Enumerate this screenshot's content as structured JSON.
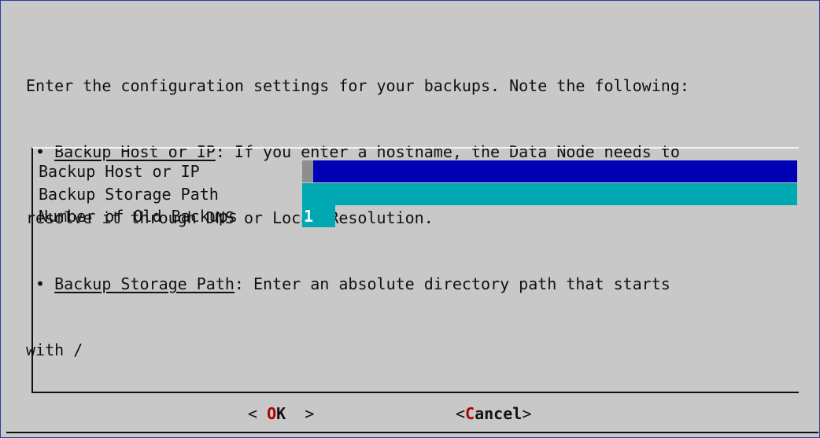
{
  "prompt": {
    "lines": [
      "Enter the configuration settings for your backups. Note the following:",
      "resolve it through DNS or Local Resolution.",
      "with /"
    ],
    "bullet_1": {
      "label": "Backup Host or IP",
      "rest": ": If you enter a hostname, the Data Node needs to"
    },
    "bullet_2": {
      "label": "Backup Storage Path",
      "rest": ": Enter an absolute directory path that starts"
    },
    "bullet_symbol": "•"
  },
  "form": {
    "fields": [
      {
        "label": "Backup Host or IP",
        "value": ""
      },
      {
        "label": "Backup Storage Path",
        "value": ""
      },
      {
        "label": "Number of Old Backups",
        "value": "1"
      }
    ]
  },
  "buttons": {
    "ok": {
      "left": "< ",
      "hot": "O",
      "rest": "K",
      "right": "  >"
    },
    "cancel": {
      "left": "<",
      "hot": "C",
      "rest": "ancel",
      "right": ">"
    }
  },
  "colors": {
    "screen_background": "#c8c8c8",
    "active_input": "#0000b4",
    "inactive_input": "#00a8b3",
    "hotkey": "#b00000"
  }
}
